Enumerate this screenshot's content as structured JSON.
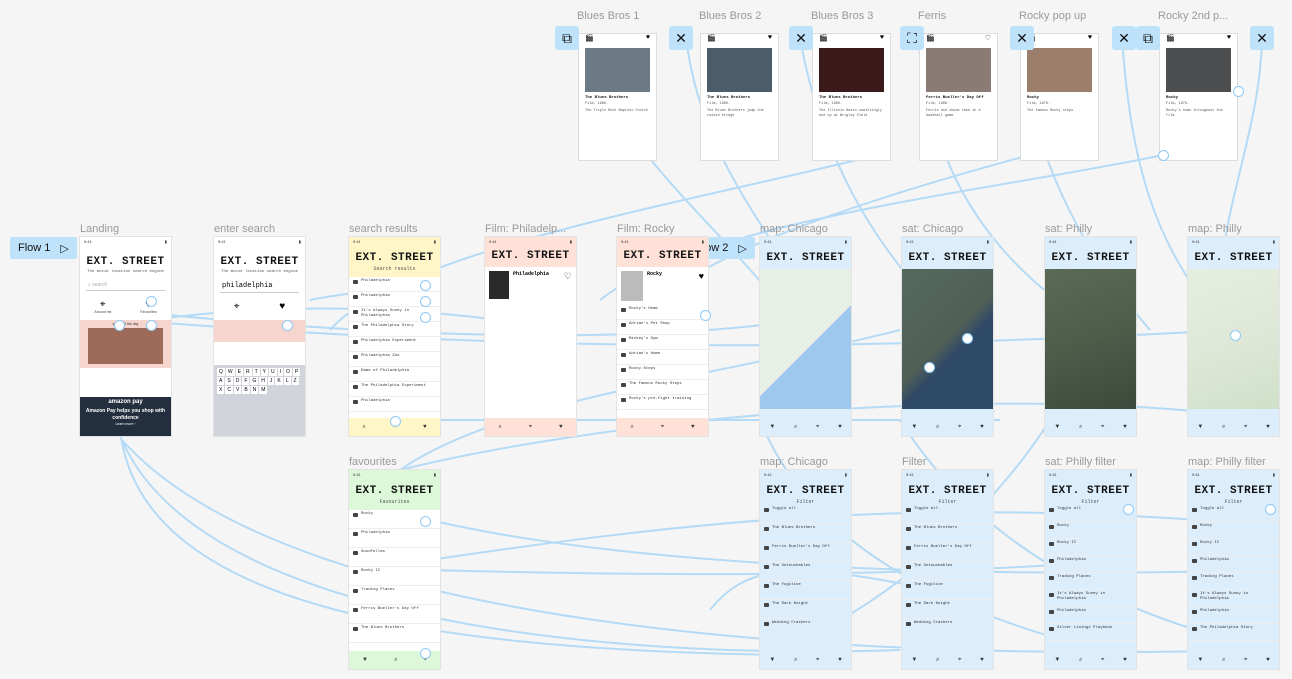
{
  "flows": [
    {
      "label": "Flow 1"
    },
    {
      "label": "Flow 2"
    }
  ],
  "frames": {
    "landing": "Landing",
    "enter_search": "enter search",
    "search_results": "search results",
    "film_philadelphia": "Film: Philadelp...",
    "film_rocky": "Film: Rocky",
    "map_chicago": "map: Chicago",
    "sat_chicago": "sat: Chicago",
    "sat_philly": "sat: Philly",
    "map_philly": "map: Philly",
    "favourites": "favourites",
    "map_chicago2": "map: Chicago",
    "filter": "Filter",
    "sat_philly_filter": "sat: Philly filter",
    "map_philly_filter": "map: Philly filter",
    "blues1": "Blues Bros 1",
    "blues2": "Blues Bros 2",
    "blues3": "Blues Bros 3",
    "ferris": "Ferris",
    "rocky_popup": "Rocky pop up",
    "rocky2": "Rocky 2nd p..."
  },
  "app": {
    "time": "9:41",
    "title": "EXT. STREET",
    "tagline": "The movie location search engine",
    "search_placeholder": "search",
    "search_value": "philadelphia",
    "around_me": "Around me",
    "favourites": "Favourites",
    "scene_of_day": "scene of the day",
    "ad_brand": "amazon pay",
    "ad_text": "Amazon Pay helps you shop with confidence",
    "ad_cta": "Learn more ›",
    "results_heading": "Search results",
    "favourites_heading": "Favourites",
    "filter_heading": "Filter",
    "film_title": "Philadelphia",
    "film_rocky": "Rocky"
  },
  "search_results": [
    "Philadelphia",
    "Philadelphia",
    "It's Always Sunny in Philadelphia",
    "The Philadelphia Story",
    "Philadelphia Experiment",
    "Philadelphia Zoo",
    "Dame of Philadelphia",
    "The Philadelphia Experiment",
    "Philadelphia"
  ],
  "favourites_list": [
    "Rocky",
    "Philadelphia",
    "Goodfellas",
    "Rocky II",
    "Trading Places",
    "Ferris Bueller's Day Off",
    "The Blues Brothers"
  ],
  "rocky_locations": [
    "Rocky's Home",
    "Adrian's Pet Shop",
    "Mickey's Gym",
    "Adrian's Home",
    "Rocky Steps",
    "The Famous Rocky Steps",
    "Rocky's pre-fight training"
  ],
  "filter_list": [
    "Toggle all",
    "The Blues Brothers",
    "Ferris Bueller's Day Off",
    "The Untouchables",
    "The Fugitive",
    "The Dark Knight",
    "Wedding Crashers"
  ],
  "philly_filter_list": [
    "Toggle all",
    "Rocky",
    "Rocky II",
    "Philadelphia",
    "Trading Places",
    "It's Always Sunny in Philadelphia",
    "Philadelphia",
    "Silver Linings Playbook",
    "The Philadelphia Story"
  ],
  "popups": [
    {
      "title": "The Blues Brothers",
      "meta": "Film, 1980.",
      "place": "The Triple Rock Baptist Church",
      "color": "#6c7a86"
    },
    {
      "title": "The Blues Brothers",
      "meta": "Film, 1980.",
      "place": "The Blues Brothers jump the raised bridge",
      "color": "#4b5d6b"
    },
    {
      "title": "The Blues Brothers",
      "meta": "Film, 1980.",
      "place": "The Illinois Nazis unwittingly end up at Wrigley Field",
      "color": "#3a1a1a"
    },
    {
      "title": "Ferris Bueller's Day Off",
      "meta": "Film, 1986.",
      "place": "Ferris and chums take in a baseball game",
      "color": "#8a7b75"
    },
    {
      "title": "Rocky",
      "meta": "Film, 1976.",
      "place": "The famous Rocky steps",
      "color": "#9b7f6a"
    },
    {
      "title": "Rocky",
      "meta": "Film, 1976.",
      "place": "Rocky's home throughout the film",
      "color": "#4d4e4f"
    }
  ],
  "colors": {
    "accent": "#bfe2fb",
    "wire": "#a9d6f7",
    "yellow": "#fff6c8",
    "pink": "#ffe1d8",
    "green": "#dcf8d8",
    "blue": "#dcedfb"
  }
}
